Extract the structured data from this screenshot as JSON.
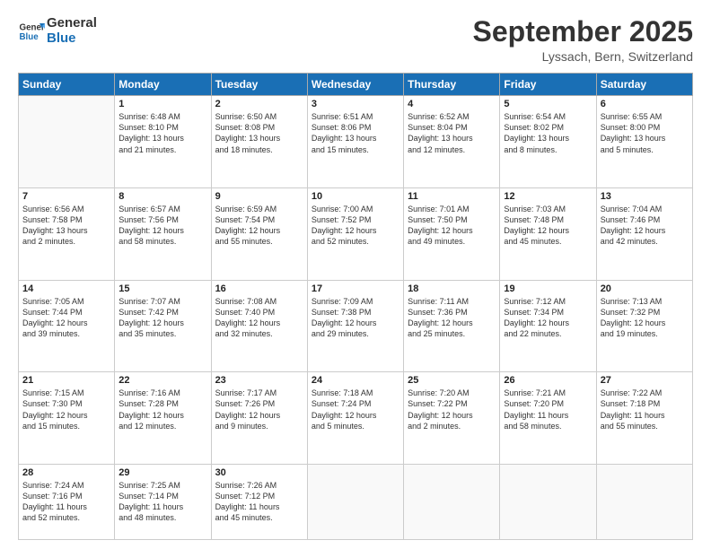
{
  "logo": {
    "line1": "General",
    "line2": "Blue"
  },
  "header": {
    "month": "September 2025",
    "location": "Lyssach, Bern, Switzerland"
  },
  "weekdays": [
    "Sunday",
    "Monday",
    "Tuesday",
    "Wednesday",
    "Thursday",
    "Friday",
    "Saturday"
  ],
  "weeks": [
    [
      {
        "day": "",
        "info": ""
      },
      {
        "day": "1",
        "info": "Sunrise: 6:48 AM\nSunset: 8:10 PM\nDaylight: 13 hours\nand 21 minutes."
      },
      {
        "day": "2",
        "info": "Sunrise: 6:50 AM\nSunset: 8:08 PM\nDaylight: 13 hours\nand 18 minutes."
      },
      {
        "day": "3",
        "info": "Sunrise: 6:51 AM\nSunset: 8:06 PM\nDaylight: 13 hours\nand 15 minutes."
      },
      {
        "day": "4",
        "info": "Sunrise: 6:52 AM\nSunset: 8:04 PM\nDaylight: 13 hours\nand 12 minutes."
      },
      {
        "day": "5",
        "info": "Sunrise: 6:54 AM\nSunset: 8:02 PM\nDaylight: 13 hours\nand 8 minutes."
      },
      {
        "day": "6",
        "info": "Sunrise: 6:55 AM\nSunset: 8:00 PM\nDaylight: 13 hours\nand 5 minutes."
      }
    ],
    [
      {
        "day": "7",
        "info": "Sunrise: 6:56 AM\nSunset: 7:58 PM\nDaylight: 13 hours\nand 2 minutes."
      },
      {
        "day": "8",
        "info": "Sunrise: 6:57 AM\nSunset: 7:56 PM\nDaylight: 12 hours\nand 58 minutes."
      },
      {
        "day": "9",
        "info": "Sunrise: 6:59 AM\nSunset: 7:54 PM\nDaylight: 12 hours\nand 55 minutes."
      },
      {
        "day": "10",
        "info": "Sunrise: 7:00 AM\nSunset: 7:52 PM\nDaylight: 12 hours\nand 52 minutes."
      },
      {
        "day": "11",
        "info": "Sunrise: 7:01 AM\nSunset: 7:50 PM\nDaylight: 12 hours\nand 49 minutes."
      },
      {
        "day": "12",
        "info": "Sunrise: 7:03 AM\nSunset: 7:48 PM\nDaylight: 12 hours\nand 45 minutes."
      },
      {
        "day": "13",
        "info": "Sunrise: 7:04 AM\nSunset: 7:46 PM\nDaylight: 12 hours\nand 42 minutes."
      }
    ],
    [
      {
        "day": "14",
        "info": "Sunrise: 7:05 AM\nSunset: 7:44 PM\nDaylight: 12 hours\nand 39 minutes."
      },
      {
        "day": "15",
        "info": "Sunrise: 7:07 AM\nSunset: 7:42 PM\nDaylight: 12 hours\nand 35 minutes."
      },
      {
        "day": "16",
        "info": "Sunrise: 7:08 AM\nSunset: 7:40 PM\nDaylight: 12 hours\nand 32 minutes."
      },
      {
        "day": "17",
        "info": "Sunrise: 7:09 AM\nSunset: 7:38 PM\nDaylight: 12 hours\nand 29 minutes."
      },
      {
        "day": "18",
        "info": "Sunrise: 7:11 AM\nSunset: 7:36 PM\nDaylight: 12 hours\nand 25 minutes."
      },
      {
        "day": "19",
        "info": "Sunrise: 7:12 AM\nSunset: 7:34 PM\nDaylight: 12 hours\nand 22 minutes."
      },
      {
        "day": "20",
        "info": "Sunrise: 7:13 AM\nSunset: 7:32 PM\nDaylight: 12 hours\nand 19 minutes."
      }
    ],
    [
      {
        "day": "21",
        "info": "Sunrise: 7:15 AM\nSunset: 7:30 PM\nDaylight: 12 hours\nand 15 minutes."
      },
      {
        "day": "22",
        "info": "Sunrise: 7:16 AM\nSunset: 7:28 PM\nDaylight: 12 hours\nand 12 minutes."
      },
      {
        "day": "23",
        "info": "Sunrise: 7:17 AM\nSunset: 7:26 PM\nDaylight: 12 hours\nand 9 minutes."
      },
      {
        "day": "24",
        "info": "Sunrise: 7:18 AM\nSunset: 7:24 PM\nDaylight: 12 hours\nand 5 minutes."
      },
      {
        "day": "25",
        "info": "Sunrise: 7:20 AM\nSunset: 7:22 PM\nDaylight: 12 hours\nand 2 minutes."
      },
      {
        "day": "26",
        "info": "Sunrise: 7:21 AM\nSunset: 7:20 PM\nDaylight: 11 hours\nand 58 minutes."
      },
      {
        "day": "27",
        "info": "Sunrise: 7:22 AM\nSunset: 7:18 PM\nDaylight: 11 hours\nand 55 minutes."
      }
    ],
    [
      {
        "day": "28",
        "info": "Sunrise: 7:24 AM\nSunset: 7:16 PM\nDaylight: 11 hours\nand 52 minutes."
      },
      {
        "day": "29",
        "info": "Sunrise: 7:25 AM\nSunset: 7:14 PM\nDaylight: 11 hours\nand 48 minutes."
      },
      {
        "day": "30",
        "info": "Sunrise: 7:26 AM\nSunset: 7:12 PM\nDaylight: 11 hours\nand 45 minutes."
      },
      {
        "day": "",
        "info": ""
      },
      {
        "day": "",
        "info": ""
      },
      {
        "day": "",
        "info": ""
      },
      {
        "day": "",
        "info": ""
      }
    ]
  ]
}
